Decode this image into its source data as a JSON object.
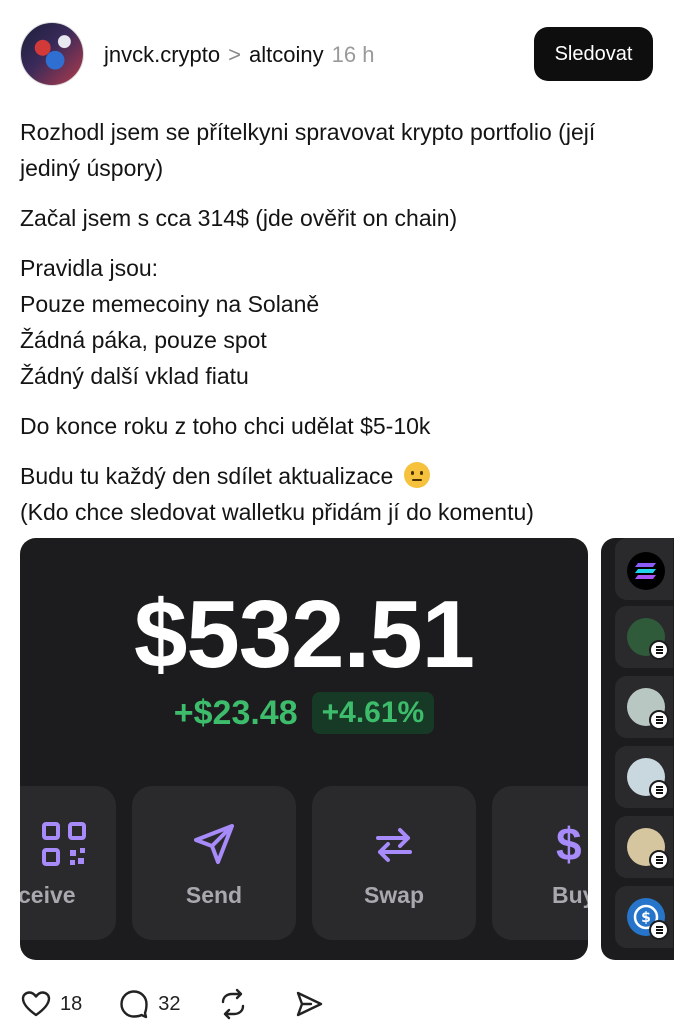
{
  "header": {
    "username": "jnvck.crypto",
    "separator": ">",
    "community": "altcoiny",
    "time": "16 h",
    "follow_label": "Sledovat"
  },
  "post": {
    "p1": "Rozhodl jsem se přítelkyni spravovat krypto portfolio (její jediný úspory)",
    "p2": "Začal jsem s cca 314$ (jde ověřit on chain)",
    "p3_l1": "Pravidla jsou:",
    "p3_l2": "Pouze memecoiny na Solaně",
    "p3_l3": "Žádná páka, pouze spot",
    "p3_l4": "Žádný další vklad fiatu",
    "p4": "Do konce roku z toho chci udělat $5-10k",
    "p5_l1": "Budu tu každý den sdílet aktualizace",
    "p5_l2": "(Kdo chce sledovat walletku přidám jí do komentu)"
  },
  "wallet": {
    "balance": "$532.51",
    "change_abs": "+$23.48",
    "change_pct": "+4.61%",
    "actions": {
      "receive": "ceive",
      "send": "Send",
      "swap": "Swap",
      "buy": "Buy"
    },
    "colors": {
      "positive": "#3dbd6b",
      "accent": "#a78bfa"
    }
  },
  "footer": {
    "likes": "18",
    "comments": "32"
  }
}
